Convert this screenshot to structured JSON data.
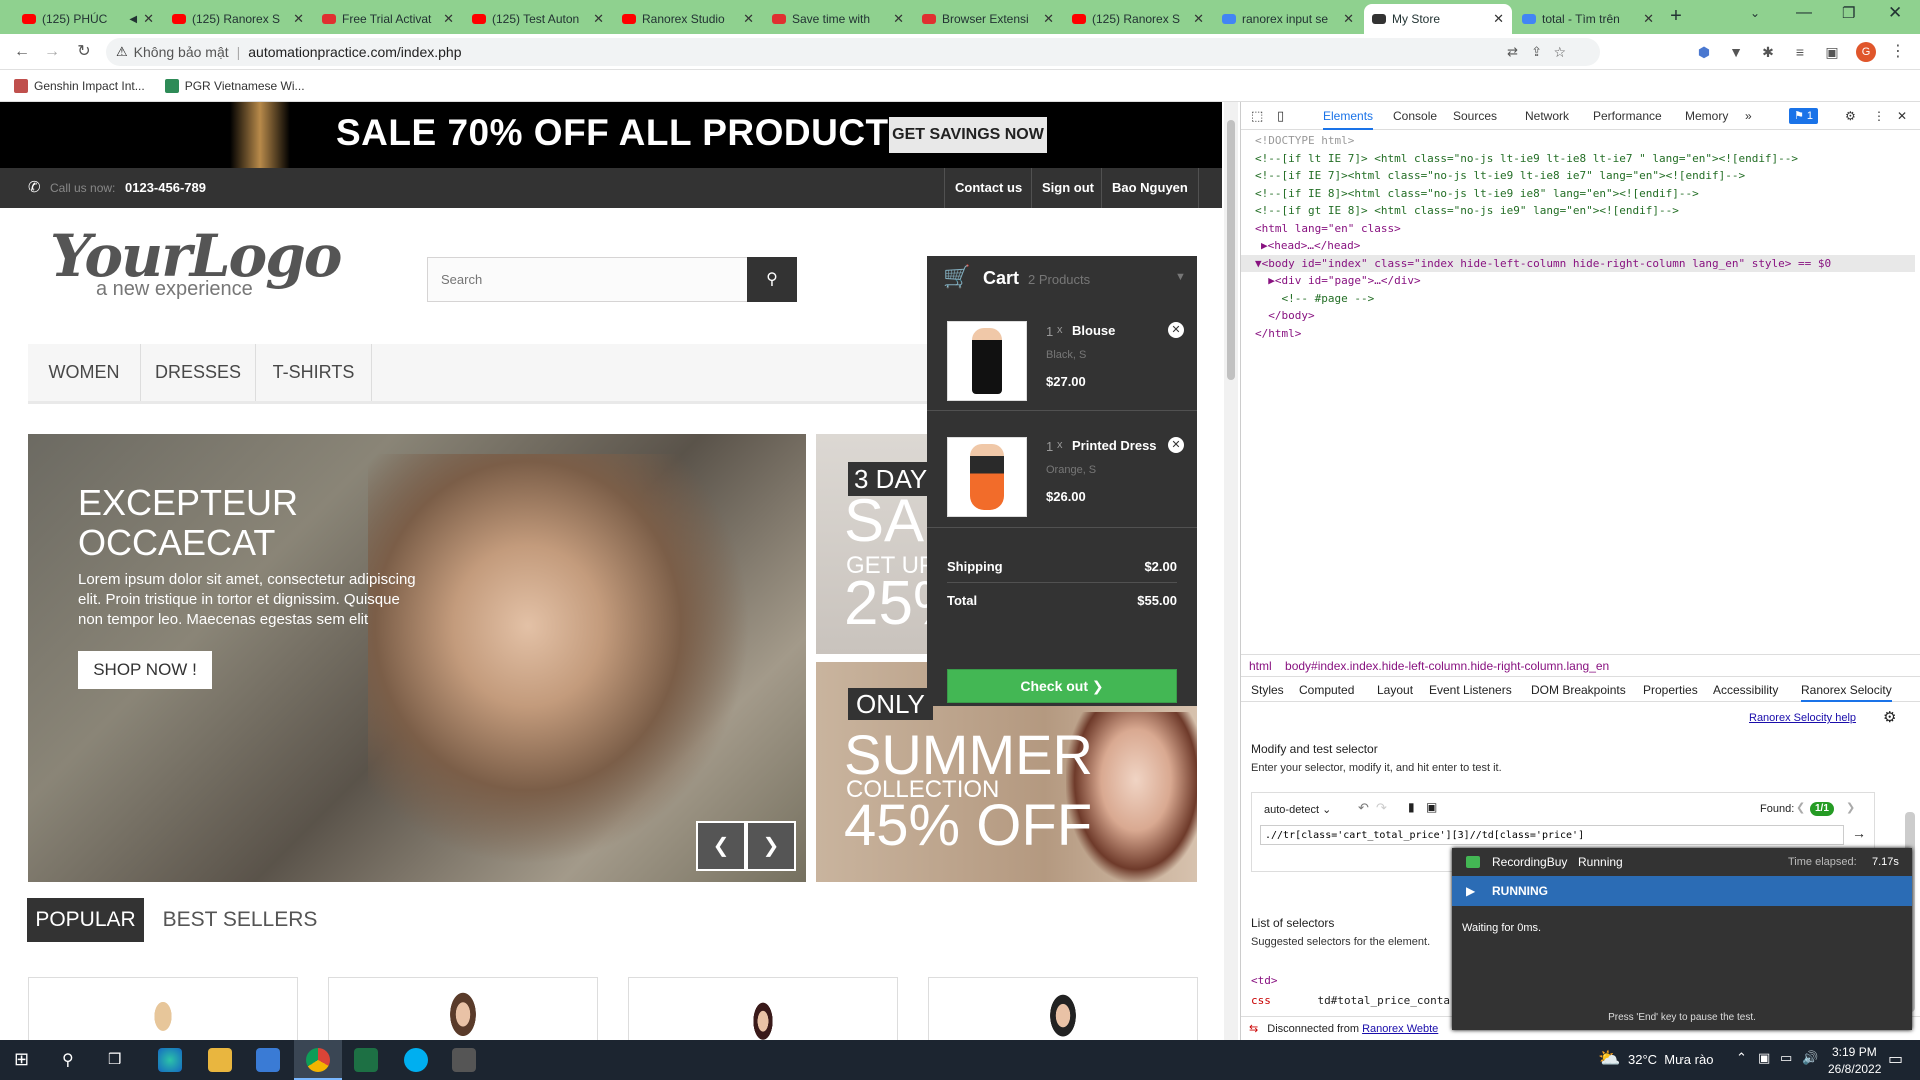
{
  "browser": {
    "tabs": [
      {
        "title": "(125) PHÚC",
        "favicon": "youtube-icon",
        "color": "#ff0000",
        "muted": true
      },
      {
        "title": "(125) Ranorex S",
        "favicon": "youtube-icon",
        "color": "#ff0000"
      },
      {
        "title": "Free Trial Activat",
        "favicon": "ranorex-icon",
        "color": "#e03030"
      },
      {
        "title": "(125) Test Auton",
        "favicon": "youtube-icon",
        "color": "#ff0000"
      },
      {
        "title": "Ranorex Studio",
        "favicon": "youtube-icon",
        "color": "#ff0000"
      },
      {
        "title": "Save time with",
        "favicon": "ranorex-icon",
        "color": "#e03030"
      },
      {
        "title": "Browser Extensi",
        "favicon": "ranorex-icon",
        "color": "#e03030"
      },
      {
        "title": "(125) Ranorex S",
        "favicon": "youtube-icon",
        "color": "#ff0000"
      },
      {
        "title": "ranorex input se",
        "favicon": "google-icon",
        "color": "#4285f4"
      },
      {
        "title": "My Store",
        "favicon": "store-icon",
        "color": "#333333",
        "active": true
      },
      {
        "title": "total - Tìm trên",
        "favicon": "google-icon",
        "color": "#4285f4"
      }
    ],
    "security_text": "Không bảo mật",
    "url": "automationpractice.com/index.php",
    "profile_initial": "G",
    "bookmarks": [
      {
        "label": "Genshin Impact Int...",
        "color": "#c0504d"
      },
      {
        "label": "PGR Vietnamese Wi...",
        "color": "#2e8b57"
      }
    ]
  },
  "store": {
    "banner": {
      "headline": "SALE 70% OFF ALL PRODUCTS",
      "button": "GET SAVINGS NOW"
    },
    "top_nav": {
      "call_label": "Call us now:",
      "phone": "0123-456-789",
      "links": [
        "Contact us",
        "Sign out",
        "Bao Nguyen"
      ]
    },
    "logo": {
      "main": "YourLogo",
      "tagline": "a new experience"
    },
    "search": {
      "placeholder": "Search"
    },
    "menu": [
      "WOMEN",
      "DRESSES",
      "T-SHIRTS"
    ],
    "cart": {
      "title": "Cart",
      "count_label": "2 Products",
      "items": [
        {
          "qty": "1",
          "times": "x",
          "name": "Blouse",
          "attrs": "Black, S",
          "price": "$27.00"
        },
        {
          "qty": "1",
          "times": "x",
          "name": "Printed Dress",
          "attrs": "Orange, S",
          "price": "$26.00"
        }
      ],
      "shipping_label": "Shipping",
      "shipping_value": "$2.00",
      "total_label": "Total",
      "total_value": "$55.00",
      "checkout": "Check out"
    },
    "hero": {
      "title_line1": "EXCEPTEUR",
      "title_line2": "OCCAECAT",
      "body": "Lorem ipsum dolor sit amet, consectetur adipiscing elit. Proin tristique in tortor et dignissim. Quisque non tempor leo. Maecenas egestas sem elit",
      "button": "SHOP NOW !"
    },
    "promo1": {
      "tag": "3 DAYS",
      "big": "SAL",
      "sub": "GET UP",
      "pct": "25%"
    },
    "promo2": {
      "tag": "ONLY",
      "big": "SUMMER",
      "sub": "COLLECTION",
      "pct": "45% OFF"
    },
    "tabs": [
      "POPULAR",
      "BEST SELLERS"
    ]
  },
  "devtools": {
    "tabs": [
      "Elements",
      "Console",
      "Sources",
      "Network",
      "Performance",
      "Memory"
    ],
    "badge": "1",
    "code_lines": [
      "<!DOCTYPE html>",
      "<!--[if lt IE 7]> <html class=\"no-js lt-ie9 lt-ie8 lt-ie7 \" lang=\"en\"><![endif]-->",
      "<!--[if IE 7]><html class=\"no-js lt-ie9 lt-ie8 ie7\" lang=\"en\"><![endif]-->",
      "<!--[if IE 8]><html class=\"no-js lt-ie9 ie8\" lang=\"en\"><![endif]-->",
      "<!--[if gt IE 8]> <html class=\"no-js ie9\" lang=\"en\"><![endif]-->",
      "<html lang=\"en\" class>",
      "▶<head>…</head>",
      "▼<body id=\"index\" class=\"index hide-left-column hide-right-column lang_en\" style> == $0",
      "  ▶<div id=\"page\">…</div>",
      "    <!-- #page -->",
      "  </body>",
      "</html>"
    ],
    "breadcrumb": [
      "html",
      "body#index.index.hide-left-column.hide-right-column.lang_en"
    ],
    "subtabs": [
      "Styles",
      "Computed",
      "Layout",
      "Event Listeners",
      "DOM Breakpoints",
      "Properties",
      "Accessibility",
      "Ranorex Selocity"
    ],
    "help_link": "Ranorex Selocity help",
    "modify_title": "Modify and test selector",
    "modify_desc": "Enter your selector, modify it, and hit enter to test it.",
    "mode": "auto-detect",
    "found_label": "Found:",
    "found_value": "1/1",
    "selector": ".//tr[class='cart_total_price'][3]//td[class='price']",
    "list_title": "List of selectors",
    "list_desc": "Suggested selectors for the element.",
    "td_tag": "<td>",
    "css_label": "css",
    "css_value": "td#total_price_conta",
    "disconnected_text": "Disconnected from",
    "disconnected_link": "Ranorex Webte"
  },
  "recording": {
    "name": "RecordingBuy",
    "state": "Running",
    "elapsed_label": "Time elapsed:",
    "elapsed_value": "7.17s",
    "status": "RUNNING",
    "message": "Waiting for 0ms.",
    "footer": "Press 'End' key to pause the test."
  },
  "taskbar": {
    "weather": "32°C  Mưa rào",
    "time": "3:19 PM",
    "date": "26/8/2022"
  }
}
